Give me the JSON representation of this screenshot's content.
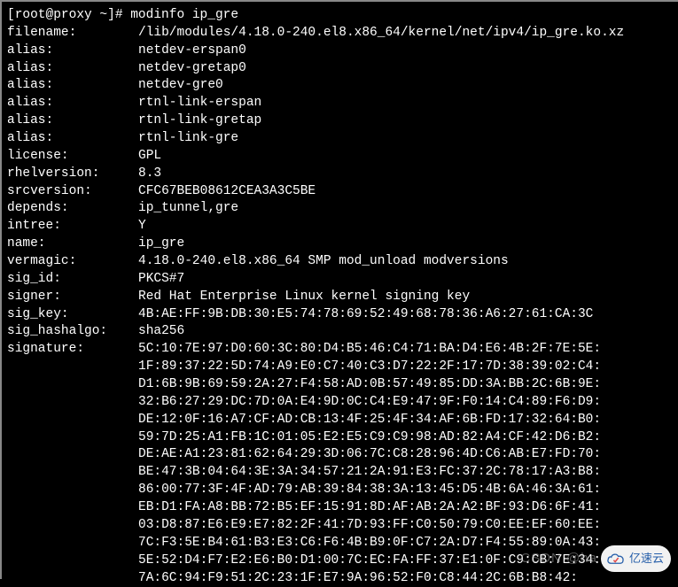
{
  "prompt": "[root@proxy ~]# ",
  "command": "modinfo ip_gre",
  "lines": [
    {
      "label": "filename:",
      "value": "/lib/modules/4.18.0-240.el8.x86_64/kernel/net/ipv4/ip_gre.ko.xz"
    },
    {
      "label": "alias:",
      "value": "netdev-erspan0"
    },
    {
      "label": "alias:",
      "value": "netdev-gretap0"
    },
    {
      "label": "alias:",
      "value": "netdev-gre0"
    },
    {
      "label": "alias:",
      "value": "rtnl-link-erspan"
    },
    {
      "label": "alias:",
      "value": "rtnl-link-gretap"
    },
    {
      "label": "alias:",
      "value": "rtnl-link-gre"
    },
    {
      "label": "license:",
      "value": "GPL"
    },
    {
      "label": "rhelversion:",
      "value": "8.3"
    },
    {
      "label": "srcversion:",
      "value": "CFC67BEB08612CEA3A3C5BE"
    },
    {
      "label": "depends:",
      "value": "ip_tunnel,gre"
    },
    {
      "label": "intree:",
      "value": "Y"
    },
    {
      "label": "name:",
      "value": "ip_gre"
    },
    {
      "label": "vermagic:",
      "value": "4.18.0-240.el8.x86_64 SMP mod_unload modversions "
    },
    {
      "label": "sig_id:",
      "value": "PKCS#7"
    },
    {
      "label": "signer:",
      "value": "Red Hat Enterprise Linux kernel signing key"
    },
    {
      "label": "sig_key:",
      "value": "4B:AE:FF:9B:DB:30:E5:74:78:69:52:49:68:78:36:A6:27:61:CA:3C"
    },
    {
      "label": "sig_hashalgo:",
      "value": "sha256"
    },
    {
      "label": "signature:",
      "value": "5C:10:7E:97:D0:60:3C:80:D4:B5:46:C4:71:BA:D4:E6:4B:2F:7E:5E:"
    }
  ],
  "sig_rest": [
    "1F:89:37:22:5D:74:A9:E0:C7:40:C3:D7:22:2F:17:7D:38:39:02:C4:",
    "D1:6B:9B:69:59:2A:27:F4:58:AD:0B:57:49:85:DD:3A:BB:2C:6B:9E:",
    "32:B6:27:29:DC:7D:0A:E4:9D:0C:C4:E9:47:9F:F0:14:C4:89:F6:D9:",
    "DE:12:0F:16:A7:CF:AD:CB:13:4F:25:4F:34:AF:6B:FD:17:32:64:B0:",
    "59:7D:25:A1:FB:1C:01:05:E2:E5:C9:C9:98:AD:82:A4:CF:42:D6:B2:",
    "DE:AE:A1:23:81:62:64:29:3D:06:7C:C8:28:96:4D:C6:AB:E7:FD:70:",
    "BE:47:3B:04:64:3E:3A:34:57:21:2A:91:E3:FC:37:2C:78:17:A3:B8:",
    "86:00:77:3F:4F:AD:79:AB:39:84:38:3A:13:45:D5:4B:6A:46:3A:61:",
    "EB:D1:FA:A8:BB:72:B5:EF:15:91:8D:AF:AB:2A:A2:BF:93:D6:6F:41:",
    "03:D8:87:E6:E9:E7:82:2F:41:7D:93:FF:C0:50:79:C0:EE:EF:60:EE:",
    "7C:F3:5E:B4:61:B3:E3:C6:F6:4B:B9:0F:C7:2A:D7:F4:55:89:0A:43:",
    "5E:52:D4:F7:E2:E6:B0:D1:00:7C:EC:FA:FF:37:E1:0F:C9:CB:7E:34:",
    "7A:6C:94:F9:51:2C:23:1F:E7:9A:96:52:F0:C8:44:2C:6B:B8:42:"
  ],
  "watermark_text": "CSDN @ha",
  "cloud_text": "亿速云"
}
